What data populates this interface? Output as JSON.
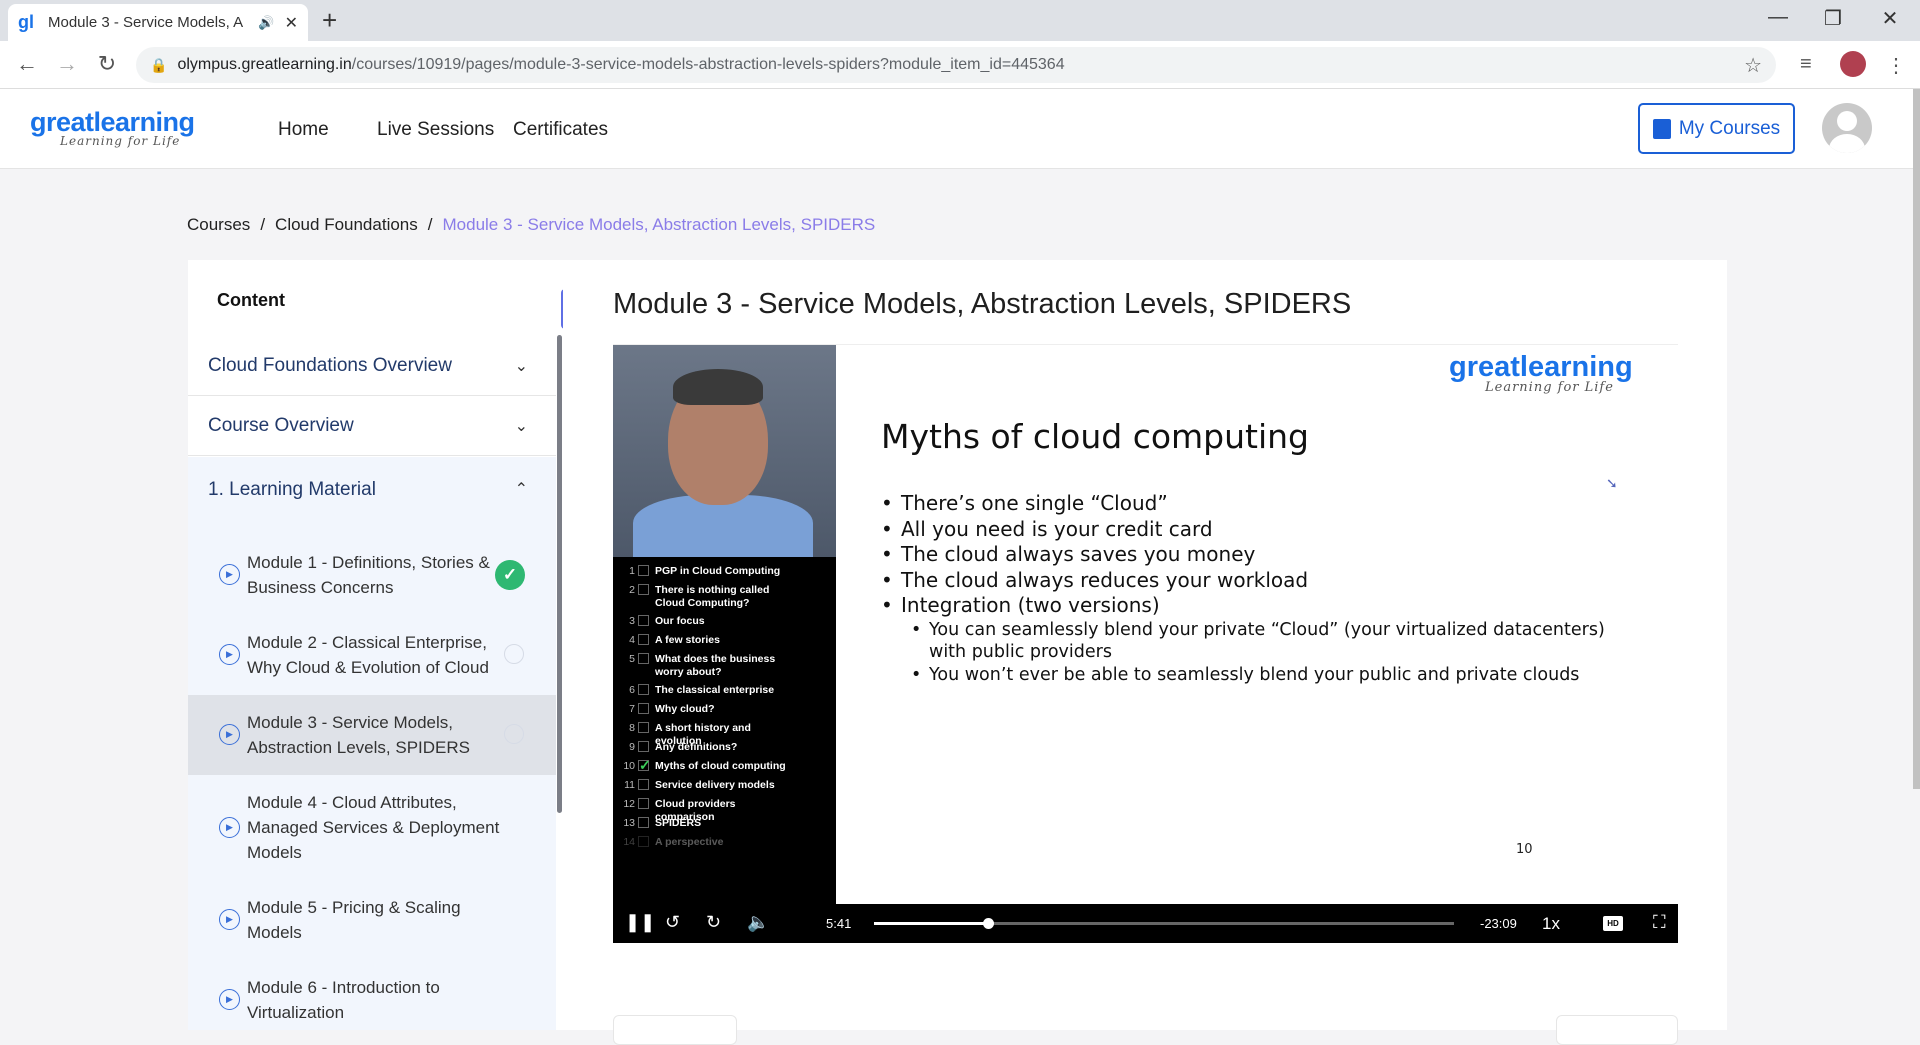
{
  "browser": {
    "tab_title": "Module 3 - Service Models, A",
    "favicon": "gl",
    "url_host": "olympus.greatlearning.in",
    "url_path": "/courses/10919/pages/module-3-service-models-abstraction-levels-spiders?module_item_id=445364"
  },
  "header": {
    "logo_brand": "greatlearning",
    "logo_tagline": "Learning for Life",
    "nav": [
      "Home",
      "Live Sessions",
      "Certificates"
    ],
    "my_courses": "My Courses"
  },
  "breadcrumb": {
    "items": [
      "Courses",
      "Cloud Foundations"
    ],
    "current": "Module 3 - Service Models, Abstraction Levels, SPIDERS",
    "separator": "/"
  },
  "sidebar": {
    "heading": "Content",
    "sections": [
      "Cloud Foundations Overview",
      "Course Overview"
    ],
    "learning_material": "1. Learning Material",
    "modules": [
      {
        "label": "Module 1 - Definitions, Stories & Business Concerns",
        "status": "completed"
      },
      {
        "label": "Module 2 - Classical Enterprise, Why Cloud & Evolution of Cloud",
        "status": "pending"
      },
      {
        "label": "Module 3 - Service Models, Abstraction Levels, SPIDERS",
        "status": "pending"
      },
      {
        "label": "Module 4 - Cloud Attributes, Managed Services & Deployment Models",
        "status": "none"
      },
      {
        "label": "Module 5 - Pricing & Scaling Models",
        "status": "none"
      },
      {
        "label": "Module 6 - Introduction to Virtualization",
        "status": "none"
      }
    ]
  },
  "main": {
    "title": "Module 3 - Service Models, Abstraction Levels, SPIDERS"
  },
  "video": {
    "toc": [
      {
        "n": "1",
        "text": "PGP in Cloud Computing",
        "checked": false
      },
      {
        "n": "2",
        "text": "There is nothing called Cloud Computing?",
        "checked": false
      },
      {
        "n": "3",
        "text": "Our focus",
        "checked": false
      },
      {
        "n": "4",
        "text": "A few stories",
        "checked": false
      },
      {
        "n": "5",
        "text": "What does the business worry about?",
        "checked": false
      },
      {
        "n": "6",
        "text": "The classical enterprise",
        "checked": false
      },
      {
        "n": "7",
        "text": "Why cloud?",
        "checked": false
      },
      {
        "n": "8",
        "text": "A short history and evolution",
        "checked": false
      },
      {
        "n": "9",
        "text": "Any definitions?",
        "checked": false
      },
      {
        "n": "10",
        "text": "Myths of cloud computing",
        "checked": true
      },
      {
        "n": "11",
        "text": "Service delivery models",
        "checked": false
      },
      {
        "n": "12",
        "text": "Cloud providers comparison",
        "checked": false
      },
      {
        "n": "13",
        "text": "SPIDERS",
        "checked": false
      },
      {
        "n": "14",
        "text": "A perspective",
        "checked": false
      }
    ],
    "slide": {
      "logo_brand": "greatlearning",
      "logo_tagline": "Learning for Life",
      "title": "Myths of cloud computing",
      "bullets": [
        "There’s one single “Cloud”",
        "All you need is your credit card",
        "The cloud always saves you money",
        "The cloud always reduces your workload",
        "Integration (two versions)"
      ],
      "sub_bullets": [
        "You can seamlessly blend your private “Cloud” (your virtualized datacenters) with public providers",
        "You won’t ever be able to seamlessly blend your public and private clouds"
      ],
      "page_number": "10"
    },
    "elapsed": "5:41",
    "remaining": "-23:09",
    "progress": 0.197,
    "speed": "1x",
    "hd_label": "HD"
  }
}
